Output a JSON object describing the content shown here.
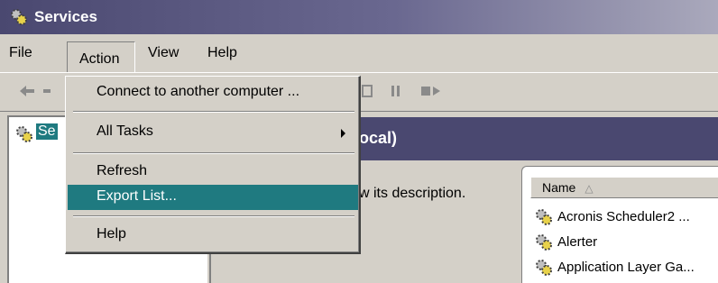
{
  "window": {
    "title": "Services"
  },
  "menubar": {
    "file": "File",
    "action": "Action",
    "view": "View",
    "help": "Help"
  },
  "tree": {
    "selected_label": "Se"
  },
  "main": {
    "header_title": "ocal)",
    "description_text": "w its description.",
    "column_name": "Name",
    "sort_indicator": "△",
    "services": [
      {
        "name": "Acronis Scheduler2 ..."
      },
      {
        "name": "Alerter"
      },
      {
        "name": "Application Layer Ga..."
      }
    ]
  },
  "action_menu": {
    "connect": "Connect to another computer ...",
    "all_tasks": "All Tasks",
    "refresh": "Refresh",
    "export_list": "Export List...",
    "help": "Help"
  },
  "colors": {
    "title_bar": "#4a4870",
    "highlight": "#1f7a80",
    "face": "#d4d0c8"
  },
  "icons": [
    "services-gear-icon",
    "back-arrow-icon",
    "forward-arrow-icon",
    "stop-icon",
    "pause-icon",
    "restart-icon",
    "submenu-arrow-icon"
  ]
}
